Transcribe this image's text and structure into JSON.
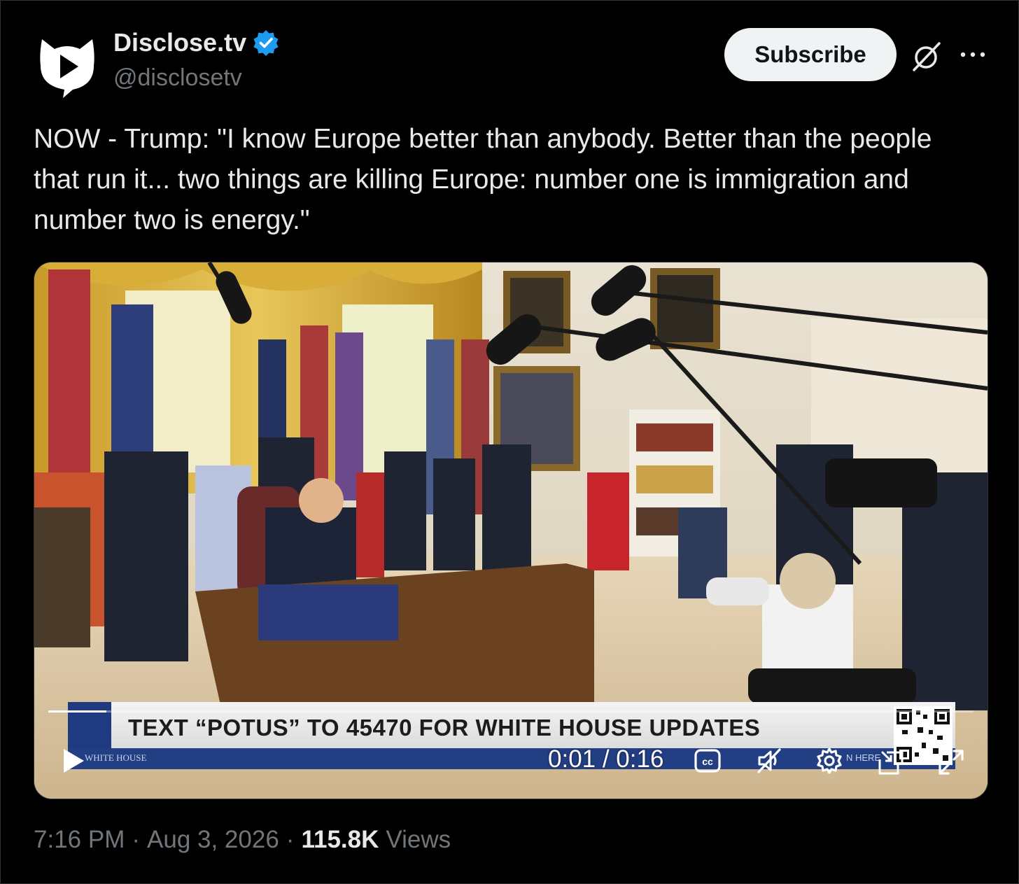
{
  "author": {
    "name": "Disclose.tv",
    "handle": "@disclosetv",
    "verified": true
  },
  "actions": {
    "subscribe_label": "Subscribe",
    "grok_icon": "grok-icon",
    "more_icon": "more-icon"
  },
  "tweet": {
    "text": "NOW - Trump: \"I know Europe better than anybody. Better than the people that run it... two things are killing Europe: number one is immigration and number two is energy.\""
  },
  "video": {
    "banner_text": "TEXT “POTUS” TO 45470 FOR WHITE HOUSE UPDATES",
    "network_label": "WHITE HOUSE",
    "corner_label": "N HERE",
    "current_time": "0:01",
    "duration": "0:16",
    "time_display": "0:01 / 0:16",
    "progress_fraction": 0.0625,
    "muted": true
  },
  "footer": {
    "time": "7:16 PM",
    "date": "Aug 3, 2026",
    "views_count": "115.8K",
    "views_label": "Views"
  },
  "colors": {
    "background": "#000000",
    "text_primary": "#e7e9ea",
    "text_secondary": "#71767b",
    "verified_blue": "#1d9bf0",
    "subscribe_bg": "#eff3f4"
  }
}
